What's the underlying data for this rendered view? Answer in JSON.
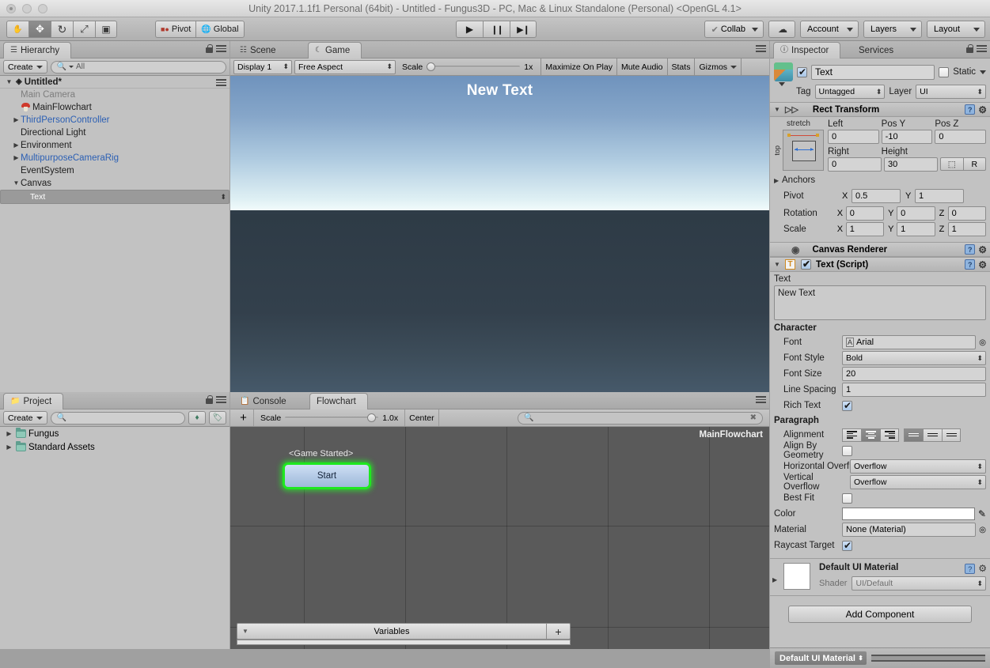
{
  "window": {
    "title": "Unity 2017.1.1f1 Personal (64bit) - Untitled - Fungus3D - PC, Mac & Linux Standalone (Personal) <OpenGL 4.1>"
  },
  "toolbar": {
    "tools": [
      {
        "name": "hand-tool",
        "glyph": "✋"
      },
      {
        "name": "move-tool",
        "glyph": "✥"
      },
      {
        "name": "rotate-tool",
        "glyph": "↻"
      },
      {
        "name": "scale-tool",
        "glyph": "⤢"
      },
      {
        "name": "rect-tool",
        "glyph": "▣"
      }
    ],
    "pivot_label": "Pivot",
    "global_label": "Global",
    "play_label": "▶",
    "pause_label": "❙❙",
    "step_label": "▶❙",
    "collab_label": "Collab",
    "cloud_label": "☁",
    "account_label": "Account",
    "layers_label": "Layers",
    "layout_label": "Layout"
  },
  "hierarchy": {
    "tab_label": "Hierarchy",
    "create_label": "Create",
    "search_placeholder": "All",
    "scene_name": "Untitled*",
    "items": [
      {
        "label": "Main Camera",
        "indent": 1,
        "arrow": "none",
        "style": "dim",
        "icon": "none"
      },
      {
        "label": "MainFlowchart",
        "indent": 1,
        "arrow": "none",
        "style": "normal",
        "icon": "mushroom"
      },
      {
        "label": "ThirdPersonController",
        "indent": 1,
        "arrow": "closed",
        "style": "prefab",
        "icon": "none"
      },
      {
        "label": "Directional Light",
        "indent": 1,
        "arrow": "none",
        "style": "normal",
        "icon": "none"
      },
      {
        "label": "Environment",
        "indent": 1,
        "arrow": "closed",
        "style": "normal",
        "icon": "none"
      },
      {
        "label": "MultipurposeCameraRig",
        "indent": 1,
        "arrow": "closed",
        "style": "prefab",
        "icon": "none"
      },
      {
        "label": "EventSystem",
        "indent": 1,
        "arrow": "none",
        "style": "normal",
        "icon": "none"
      },
      {
        "label": "Canvas",
        "indent": 1,
        "arrow": "open",
        "style": "normal",
        "icon": "none"
      },
      {
        "label": "Text",
        "indent": 2,
        "arrow": "none",
        "style": "selected",
        "icon": "none"
      }
    ]
  },
  "project": {
    "tab_label": "Project",
    "create_label": "Create",
    "search_placeholder": "",
    "items": [
      {
        "label": "Fungus"
      },
      {
        "label": "Standard Assets"
      }
    ]
  },
  "gameview": {
    "tabs": [
      {
        "label": "Scene",
        "icon": "grid-icon",
        "active": false
      },
      {
        "label": "Game",
        "icon": "moon-icon",
        "active": true
      }
    ],
    "display_label": "Display 1",
    "aspect_label": "Free Aspect",
    "scale_label": "Scale",
    "scale_value": "1x",
    "maximize_label": "Maximize On Play",
    "mute_label": "Mute Audio",
    "stats_label": "Stats",
    "gizmos_label": "Gizmos",
    "overlay_text": "New Text"
  },
  "flowchart": {
    "tabs": [
      {
        "label": "Console",
        "icon": "console-icon",
        "active": false
      },
      {
        "label": "Flowchart",
        "icon": "none",
        "active": true
      }
    ],
    "add_label": "+",
    "scale_label": "Scale",
    "scale_value": "1.0x",
    "center_label": "Center",
    "search_placeholder": "",
    "chart_title": "MainFlowchart",
    "node_event_label": "<Game Started>",
    "node_label": "Start",
    "variables_label": "Variables",
    "variables_add_label": "+"
  },
  "inspector": {
    "tabs": [
      {
        "label": "Inspector",
        "active": true
      },
      {
        "label": "Services",
        "active": false
      }
    ],
    "object_name": "Text",
    "object_enabled": true,
    "static_label": "Static",
    "tag_label": "Tag",
    "tag_value": "Untagged",
    "layer_label": "Layer",
    "layer_value": "UI",
    "rect_transform": {
      "title": "Rect Transform",
      "anchor_preset_label": "stretch",
      "anchor_vertical_label": "top",
      "left_label": "Left",
      "left_value": "0",
      "posy_label": "Pos Y",
      "posy_value": "-10",
      "posz_label": "Pos Z",
      "posz_value": "0",
      "right_label": "Right",
      "right_value": "0",
      "height_label": "Height",
      "height_value": "30",
      "blueprint_label": "⬚",
      "raw_label": "R",
      "anchors_label": "Anchors",
      "pivot_label": "Pivot",
      "pivot_x": "0.5",
      "pivot_y": "1",
      "rotation_label": "Rotation",
      "rot_x": "0",
      "rot_y": "0",
      "rot_z": "0",
      "scale_label": "Scale",
      "scale_x": "1",
      "scale_y": "1",
      "scale_z": "1"
    },
    "canvas_renderer": {
      "title": "Canvas Renderer"
    },
    "text_script": {
      "title": "Text (Script)",
      "enabled": true,
      "text_label": "Text",
      "text_value": "New Text",
      "character_label": "Character",
      "font_label": "Font",
      "font_value": "Arial",
      "font_style_label": "Font Style",
      "font_style_value": "Bold",
      "font_size_label": "Font Size",
      "font_size_value": "20",
      "line_spacing_label": "Line Spacing",
      "line_spacing_value": "1",
      "rich_text_label": "Rich Text",
      "rich_text_value": true,
      "paragraph_label": "Paragraph",
      "alignment_label": "Alignment",
      "align_horizontal_selected": 1,
      "align_vertical_selected": 0,
      "align_by_geometry_label": "Align By Geometry",
      "align_by_geometry_value": false,
      "h_overflow_label": "Horizontal Overflow",
      "h_overflow_value": "Overflow",
      "v_overflow_label": "Vertical Overflow",
      "v_overflow_value": "Overflow",
      "best_fit_label": "Best Fit",
      "best_fit_value": false,
      "color_label": "Color",
      "color_value": "#FFFFFF",
      "material_label": "Material",
      "material_value": "None (Material)",
      "raycast_label": "Raycast Target",
      "raycast_value": true
    },
    "material": {
      "title": "Default UI Material",
      "shader_label": "Shader",
      "shader_value": "UI/Default"
    },
    "add_component_label": "Add Component",
    "footer_label": "Default UI Material"
  }
}
